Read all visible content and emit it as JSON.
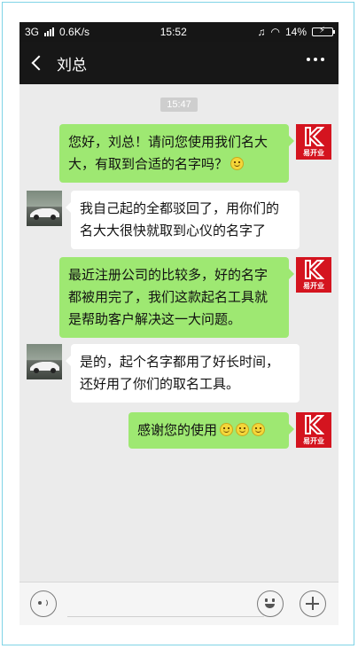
{
  "status_bar": {
    "network": "3G",
    "speed": "0.6K/s",
    "time": "15:52",
    "battery": "14%"
  },
  "header": {
    "contact_name": "刘总",
    "more_label": "⋯"
  },
  "chat": {
    "timestamp": "15:47",
    "messages": [
      {
        "sender": "me",
        "lines": [
          "您好，刘总！请问您使用我们名大",
          "大，有取到合适的名字吗？"
        ],
        "emoji_count": 1
      },
      {
        "sender": "them",
        "lines": [
          "我自己起的全都驳回了，用你们的",
          "名大大很快就取到心仪的名字了"
        ],
        "emoji_count": 0
      },
      {
        "sender": "me",
        "lines": [
          "最近注册公司的比较多，好的名字",
          "都被用完了，我们这款起名工具就",
          "是帮助客户解决这一大问题。"
        ],
        "emoji_count": 0
      },
      {
        "sender": "them",
        "lines": [
          "是的，起个名字都用了好长时间，",
          "还好用了你们的取名工具。"
        ],
        "emoji_count": 0
      },
      {
        "sender": "me",
        "lines": [
          "感谢您的使用"
        ],
        "emoji_count": 3
      }
    ],
    "brand_logo_text": "易开业"
  },
  "input_bar": {
    "placeholder": ""
  }
}
